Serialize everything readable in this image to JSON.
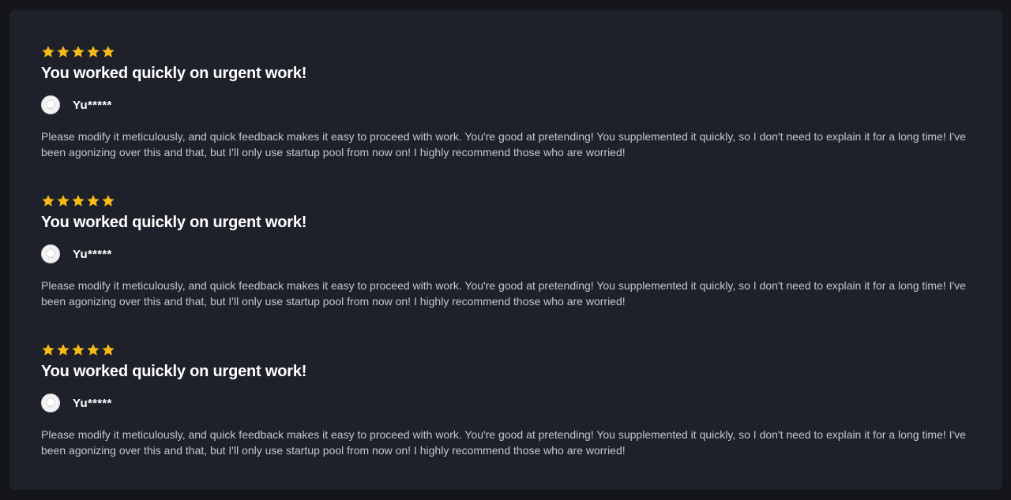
{
  "star_color": "#f5b918",
  "reviews": [
    {
      "rating": 5,
      "title": "You worked quickly on urgent work!",
      "author": "Yu*****",
      "avatar_icon": "user-avatar-icon",
      "text": "Please modify it meticulously, and quick feedback makes it easy to proceed with work. You're good at pretending! You supplemented it quickly, so I don't need to explain it for a long time! I've been agonizing over this and that, but I'll only use startup pool from now on! I highly recommend those who are worried!"
    },
    {
      "rating": 5,
      "title": "You worked quickly on urgent work!",
      "author": "Yu*****",
      "avatar_icon": "user-avatar-icon",
      "text": "Please modify it meticulously, and quick feedback makes it easy to proceed with work. You're good at pretending! You supplemented it quickly, so I don't need to explain it for a long time! I've been agonizing over this and that, but I'll only use startup pool from now on! I highly recommend those who are worried!"
    },
    {
      "rating": 5,
      "title": "You worked quickly on urgent work!",
      "author": "Yu*****",
      "avatar_icon": "user-avatar-icon",
      "text": "Please modify it meticulously, and quick feedback makes it easy to proceed with work. You're good at pretending! You supplemented it quickly, so I don't need to explain it for a long time! I've been agonizing over this and that, but I'll only use startup pool from now on! I highly recommend those who are worried!"
    }
  ]
}
